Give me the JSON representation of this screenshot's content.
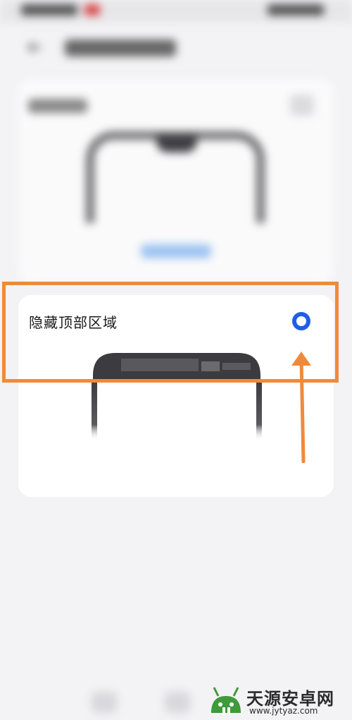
{
  "option": {
    "label": "隐藏顶部区域",
    "selected": true
  },
  "colors": {
    "accent": "#1f5fe6",
    "highlight": "#f08a3a"
  },
  "icons": {
    "back": "back-arrow-icon",
    "radio": "radio-selected-icon"
  },
  "watermark": {
    "name": "天源安卓网",
    "url": "www.jytyaz.com"
  }
}
